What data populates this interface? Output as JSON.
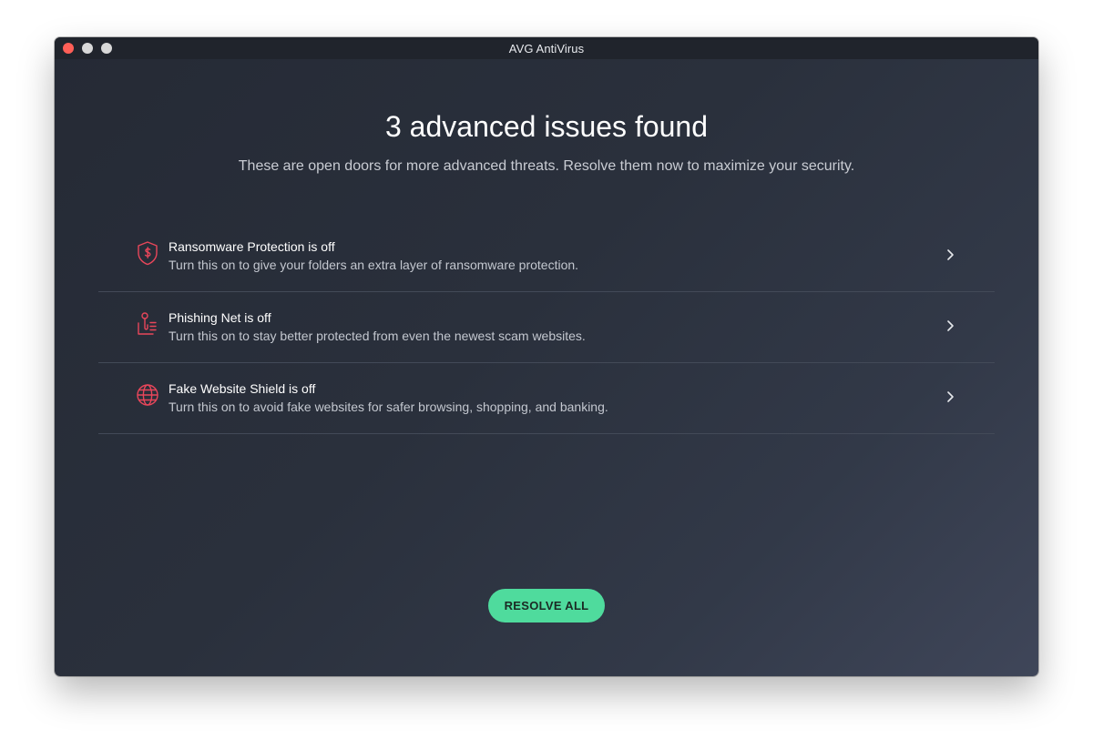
{
  "window": {
    "title": "AVG AntiVirus"
  },
  "header": {
    "title": "3 advanced issues found",
    "subtitle": "These are open doors for more advanced threats. Resolve them now to maximize your security."
  },
  "issues": [
    {
      "icon": "ransomware-shield-icon",
      "title": "Ransomware Protection is off",
      "description": "Turn this on to give your folders an extra layer of ransomware protection."
    },
    {
      "icon": "phishing-hook-icon",
      "title": "Phishing Net is off",
      "description": "Turn this on to stay better protected from even the newest scam websites."
    },
    {
      "icon": "globe-icon",
      "title": "Fake Website Shield is off",
      "description": "Turn this on to avoid fake websites for safer browsing, shopping, and banking."
    }
  ],
  "actions": {
    "resolve_all_label": "RESOLVE ALL"
  },
  "colors": {
    "accent": "#4fdb9d",
    "issue_icon": "#e8465a",
    "close_button": "#ff5f57"
  }
}
